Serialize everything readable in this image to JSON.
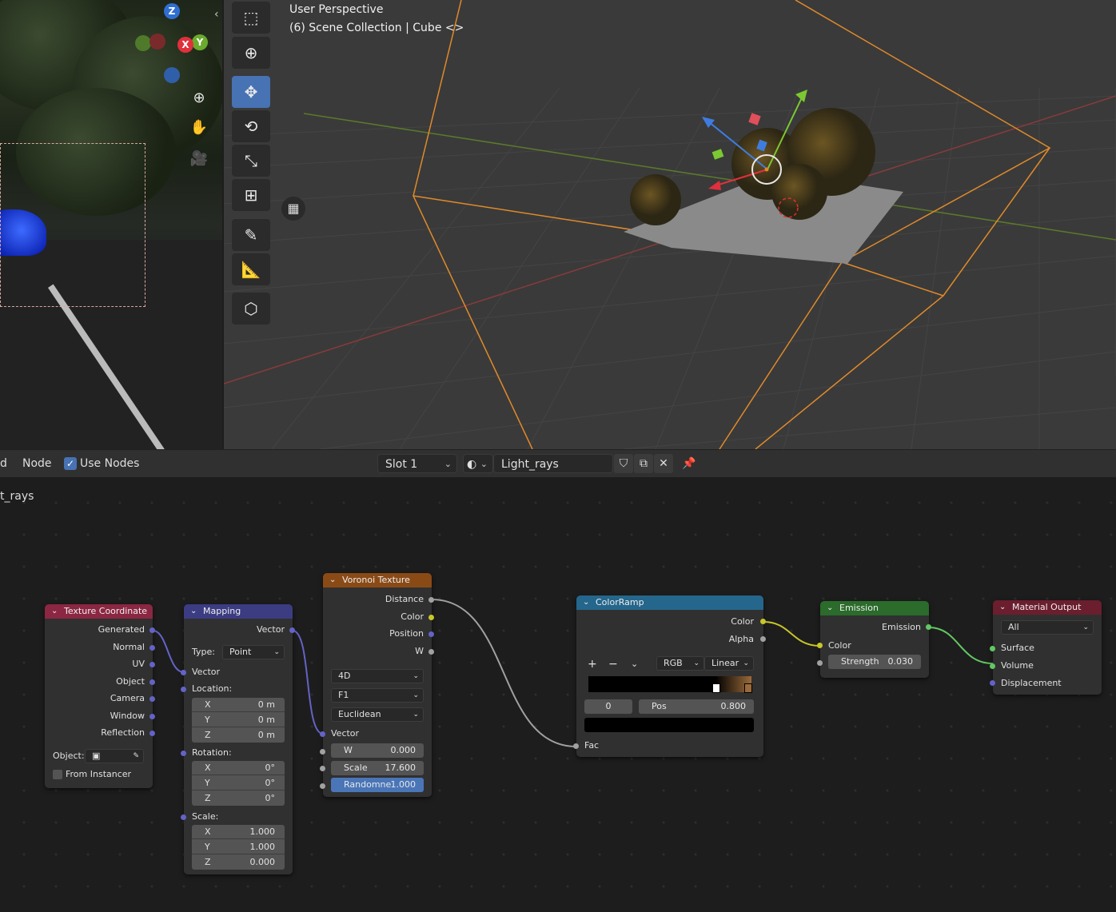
{
  "viewport": {
    "title": "User Perspective",
    "subtitle": "(6) Scene Collection | Cube <>",
    "tools": [
      "select-box-icon",
      "cursor-icon",
      "move-icon",
      "rotate-icon",
      "scale-icon",
      "transform-icon",
      "annotate-icon",
      "measure-icon",
      "add-cube-icon"
    ],
    "gizmo": {
      "z": "Z",
      "x": "X",
      "y": "Y"
    }
  },
  "header": {
    "left_cut": "d",
    "menu_node": "Node",
    "use_nodes_label": "Use Nodes",
    "slot": "Slot 1",
    "material": "Light_rays"
  },
  "editor": {
    "material_label": "t_rays"
  },
  "nodes": {
    "texcoord": {
      "title": "Texture Coordinate",
      "outputs": [
        "Generated",
        "Normal",
        "UV",
        "Object",
        "Camera",
        "Window",
        "Reflection"
      ],
      "object_label": "Object:",
      "from_instancer": "From Instancer"
    },
    "mapping": {
      "title": "Mapping",
      "out_vector": "Vector",
      "type_label": "Type:",
      "type_value": "Point",
      "in_vector": "Vector",
      "location_label": "Location:",
      "location": [
        {
          "axis": "X",
          "val": "0 m"
        },
        {
          "axis": "Y",
          "val": "0 m"
        },
        {
          "axis": "Z",
          "val": "0 m"
        }
      ],
      "rotation_label": "Rotation:",
      "rotation": [
        {
          "axis": "X",
          "val": "0°"
        },
        {
          "axis": "Y",
          "val": "0°"
        },
        {
          "axis": "Z",
          "val": "0°"
        }
      ],
      "scale_label": "Scale:",
      "scale": [
        {
          "axis": "X",
          "val": "1.000"
        },
        {
          "axis": "Y",
          "val": "1.000"
        },
        {
          "axis": "Z",
          "val": "0.000"
        }
      ]
    },
    "voronoi": {
      "title": "Voronoi Texture",
      "outputs": [
        "Distance",
        "Color",
        "Position",
        "W"
      ],
      "dim": "4D",
      "feature": "F1",
      "metric": "Euclidean",
      "in_vector": "Vector",
      "w_label": "W",
      "w_val": "0.000",
      "scale_label": "Scale",
      "scale_val": "17.600",
      "rand_label": "Randomne",
      "rand_val": "1.000"
    },
    "colorramp": {
      "title": "ColorRamp",
      "outputs": [
        "Color",
        "Alpha"
      ],
      "plus": "+",
      "minus": "−",
      "mode": "RGB",
      "interp": "Linear",
      "index": "0",
      "pos_label": "Pos",
      "pos_val": "0.800",
      "in_fac": "Fac"
    },
    "emission": {
      "title": "Emission",
      "out": "Emission",
      "color_label": "Color",
      "strength_label": "Strength",
      "strength_val": "0.030"
    },
    "output": {
      "title": "Material Output",
      "target": "All",
      "inputs": [
        "Surface",
        "Volume",
        "Displacement"
      ]
    }
  },
  "colors": {
    "header_texcoord": "#8b2742",
    "header_mapping": "#3c3c83",
    "header_voronoi": "#8a4a16",
    "header_colorramp": "#24668c",
    "header_emission": "#2b6b2b",
    "header_output": "#6b1e2e",
    "socket_vector": "#6363c7",
    "socket_color": "#c7c729",
    "socket_float": "#a1a1a1",
    "socket_shader": "#63c763",
    "accent": "#4772b3"
  }
}
